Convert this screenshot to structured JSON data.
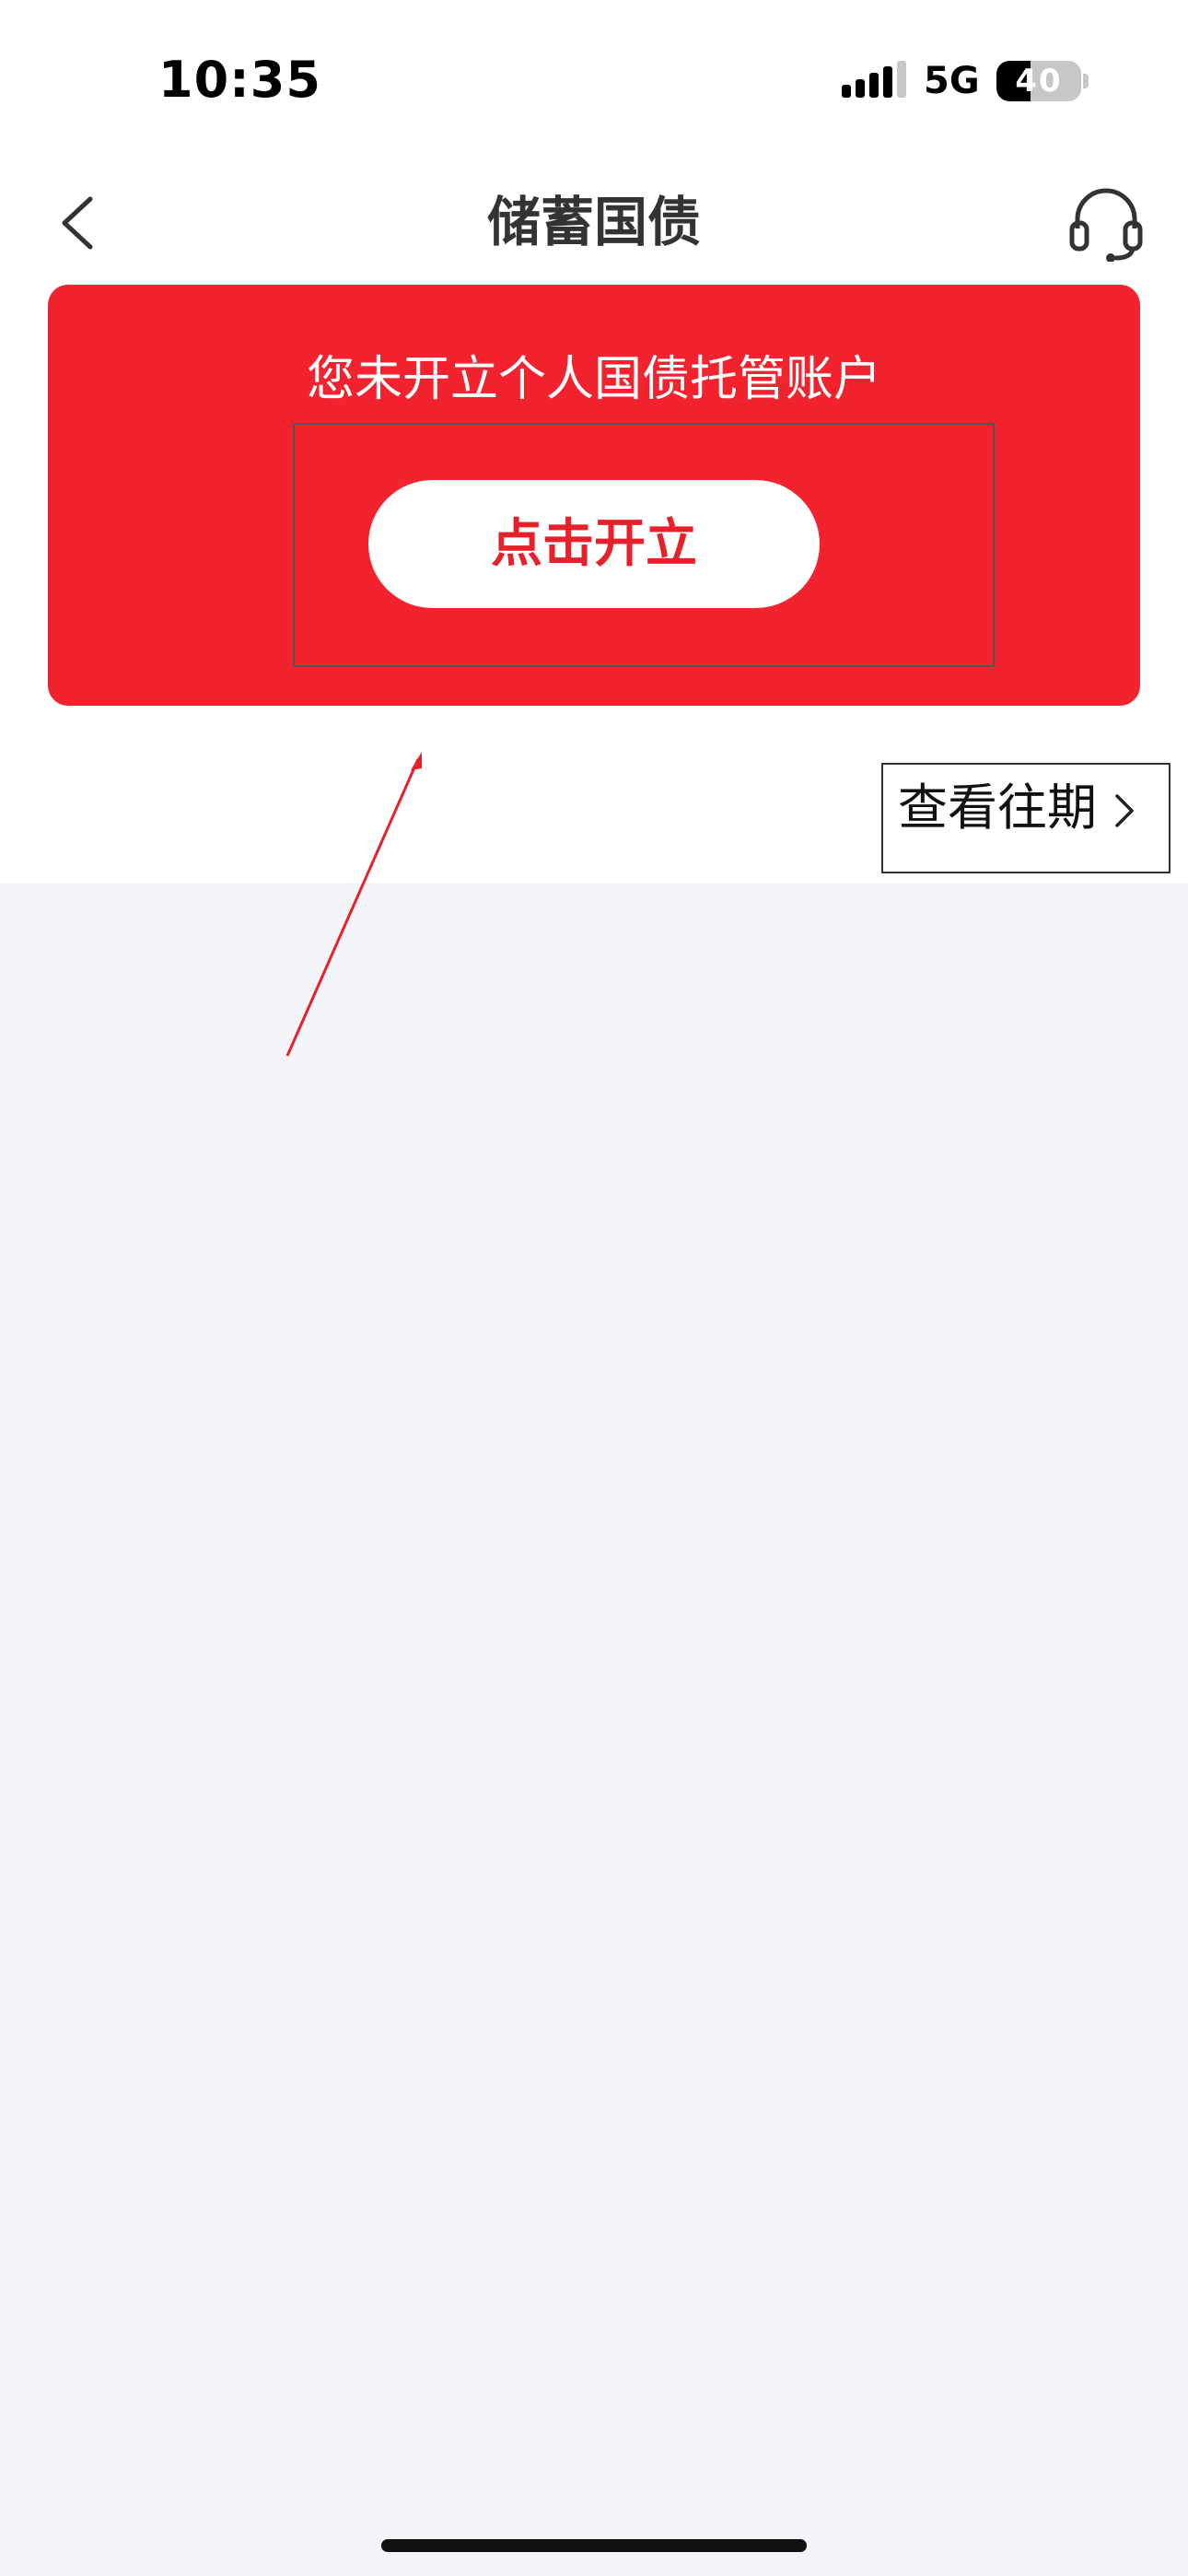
{
  "status_bar": {
    "time": "10:35",
    "network": "5G",
    "battery": "40",
    "battery_level_percent": 40
  },
  "nav": {
    "title": "储蓄国债",
    "back_icon": "chevron-left-icon",
    "service_icon": "headset-icon"
  },
  "card": {
    "message": "您未开立个人国债托管账户",
    "button_label": "点击开立"
  },
  "history_link": {
    "label": "查看往期",
    "icon": "chevron-right-icon"
  },
  "colors": {
    "brand_red": "#f2232e",
    "button_text": "#e8202b",
    "background": "#f4f5f9"
  }
}
